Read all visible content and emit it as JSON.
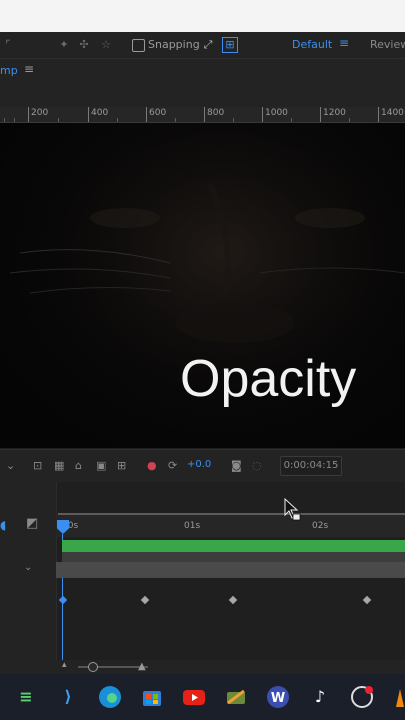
{
  "toolbar": {
    "snapping_label": "Snapping",
    "workspace_default": "Default",
    "workspace_menu_icon": "≡",
    "workspace_review": "Review"
  },
  "comp_panel": {
    "tab_label": "mp",
    "tab_menu_icon": "≡"
  },
  "ruler": {
    "labels": [
      "200",
      "400",
      "600",
      "800",
      "1000",
      "1200",
      "1400"
    ]
  },
  "viewer": {
    "overlay_text": "Opacity"
  },
  "viewer_controls": {
    "exposure_value": "+0.0",
    "timecode": "0:00:04:15"
  },
  "timeline": {
    "time_labels": [
      "00s",
      "01s",
      "02s"
    ]
  },
  "taskbar": {
    "apps": [
      "fluent-app",
      "vscode",
      "edge",
      "store",
      "youtube",
      "tools",
      "word-w",
      "tiktok",
      "obs",
      "vlc"
    ]
  }
}
